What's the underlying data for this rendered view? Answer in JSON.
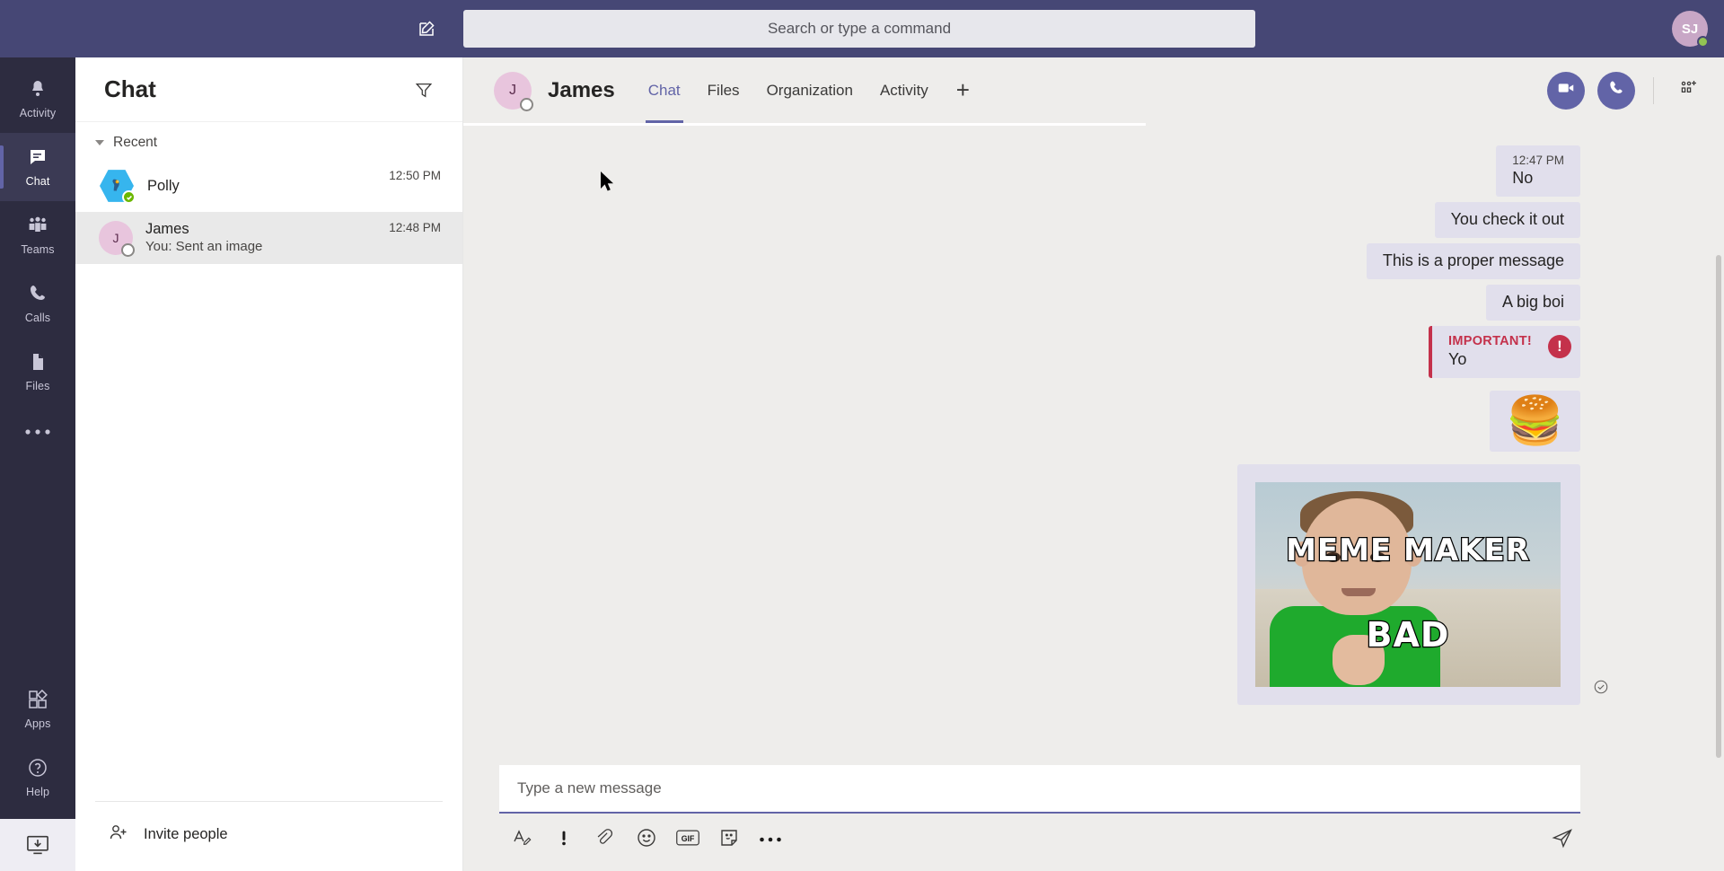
{
  "topbar": {
    "compose_icon": "compose-icon",
    "search": {
      "placeholder": "Search or type a command",
      "value": ""
    },
    "avatar": {
      "initials": "SJ",
      "presence": "available",
      "presence_color": "#92c353"
    },
    "background_color": "#464775"
  },
  "rail": {
    "items": [
      {
        "label": "Activity",
        "icon": "bell-icon",
        "active": false
      },
      {
        "label": "Chat",
        "icon": "chat-bubble-icon",
        "active": true
      },
      {
        "label": "Teams",
        "icon": "people-icon",
        "active": false
      },
      {
        "label": "Calls",
        "icon": "phone-icon",
        "active": false
      },
      {
        "label": "Files",
        "icon": "file-icon",
        "active": false
      }
    ],
    "more_label": "...",
    "bottom_items": [
      {
        "label": "Apps",
        "icon": "apps-icon"
      },
      {
        "label": "Help",
        "icon": "help-circle-icon"
      }
    ],
    "install_icon": "download-desktop-app-icon",
    "background_color": "#2d2c40"
  },
  "chat_list": {
    "title": "Chat",
    "filter_icon": "filter-funnel-icon",
    "group_label": "Recent",
    "rows": [
      {
        "name": "Polly",
        "preview": "",
        "time": "12:50 PM",
        "avatar_type": "hex-bot",
        "avatar_initials": "",
        "presence": "available",
        "selected": false
      },
      {
        "name": "James",
        "preview": "You: Sent an image",
        "time": "12:48 PM",
        "avatar_type": "initials",
        "avatar_initials": "J",
        "presence": "offline",
        "selected": true
      }
    ],
    "invite_label": "Invite people",
    "invite_icon": "add-person-icon"
  },
  "conversation": {
    "avatar_initials": "J",
    "title": "James",
    "presence": "offline",
    "tabs": [
      {
        "label": "Chat",
        "active": true
      },
      {
        "label": "Files",
        "active": false
      },
      {
        "label": "Organization",
        "active": false
      },
      {
        "label": "Activity",
        "active": false
      }
    ],
    "add_tab_label": "+",
    "actions": [
      {
        "name": "video-call-button",
        "icon": "video-camera-icon"
      },
      {
        "name": "audio-call-button",
        "icon": "phone-icon"
      },
      {
        "name": "add-people-button",
        "icon": "add-participant-icon"
      }
    ],
    "accent_color": "#6264a7",
    "messages": [
      {
        "type": "text",
        "time": "12:47 PM",
        "text": "No",
        "important": false
      },
      {
        "type": "text",
        "time": "",
        "text": "You check it out",
        "important": false
      },
      {
        "type": "text",
        "time": "",
        "text": "This is a proper message",
        "important": false
      },
      {
        "type": "text",
        "time": "",
        "text": "A big boi",
        "important": false
      },
      {
        "type": "text",
        "time": "",
        "text": "Yo",
        "important": true,
        "important_label": "IMPORTANT!",
        "important_color": "#c4314b"
      },
      {
        "type": "emoji",
        "text": "🍔"
      },
      {
        "type": "image",
        "alt": "Success Kid meme",
        "meme_top_text": "MEME MAKER",
        "meme_bottom_text": "BAD",
        "delivered": true
      }
    ]
  },
  "compose": {
    "placeholder": "Type a new message",
    "value": "",
    "tools": [
      {
        "name": "format-text-button",
        "icon": "format-A-pen-icon",
        "label": "A"
      },
      {
        "name": "set-importance-button",
        "icon": "exclamation-icon",
        "label": "!"
      },
      {
        "name": "attach-file-button",
        "icon": "paperclip-icon",
        "label": ""
      },
      {
        "name": "emoji-button",
        "icon": "smiley-icon",
        "label": ""
      },
      {
        "name": "giphy-button",
        "icon": "gif-icon",
        "label": "GIF"
      },
      {
        "name": "sticker-button",
        "icon": "sticker-icon",
        "label": ""
      },
      {
        "name": "more-options-button",
        "icon": "ellipsis-icon",
        "label": ""
      }
    ],
    "send_icon": "send-paper-plane-icon"
  }
}
